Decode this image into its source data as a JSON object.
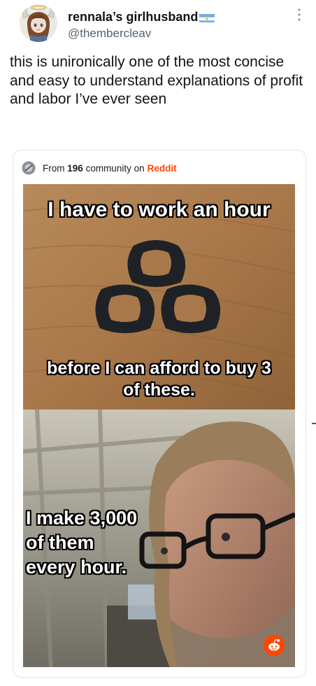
{
  "tweet": {
    "display_name": "rennala’s girlhusband",
    "handle": "@thembercleav",
    "text": "this is unironically one of the most concise and easy to understand explanations of profit and labor I’ve ever seen"
  },
  "embed": {
    "source_prefix": "From",
    "community_count": "196",
    "community_word": "community on",
    "platform": "Reddit",
    "meme": {
      "top_caption": "I have to work an hour",
      "middle_caption_line1": "before I can afford to buy 3",
      "middle_caption_line2": "of these.",
      "bottom_caption_line1": "I make 3,000",
      "bottom_caption_line2": "of them",
      "bottom_caption_line3": "every hour."
    }
  },
  "icons": {
    "avatar": "anime-avatar-icon",
    "flag": "flag-icon",
    "more": "more-vertical-icon",
    "community": "community-icon",
    "reddit": "reddit-logo-icon"
  },
  "colors": {
    "text": "#0f1419",
    "secondary_text": "#536471",
    "reddit": "#ff4500",
    "card_border": "#e1e4e8"
  }
}
